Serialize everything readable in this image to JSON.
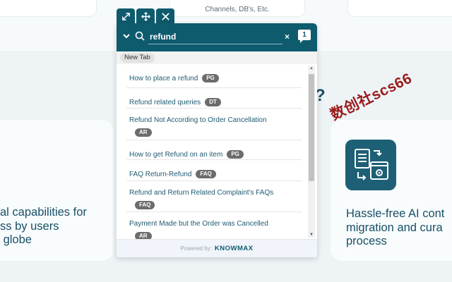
{
  "background": {
    "top_mid_card_text": "Channels, DB's, Etc.",
    "question_mark": "?",
    "left_text": "al capabilities for\nss by users\n globe",
    "right_text": "Hassle-free AI cont\nmigration and cura\nprocess",
    "watermark": "数创社scs66"
  },
  "widget": {
    "controls": [
      "expand-icon",
      "move-icon",
      "close-icon"
    ],
    "search": {
      "value": "refund",
      "placeholder": "Search",
      "clear_label": "×",
      "result_count": "1"
    },
    "tab_label": "New Tab",
    "results": [
      {
        "title": "How to place a refund",
        "tag": "PG"
      },
      {
        "title": "Refund related queries",
        "tag": "DT"
      },
      {
        "title": "Refund Not According to Order Cancellation",
        "tag": "AR"
      },
      {
        "title": "How to get Refund on an item",
        "tag": "PG"
      },
      {
        "title": "FAQ Return-Refund",
        "tag": "FAQ"
      },
      {
        "title": "Refund and Return Related Complaint's FAQs",
        "tag": "FAQ"
      },
      {
        "title": "Payment Made but the Order was Cancelled",
        "tag": "AR"
      }
    ],
    "footer": {
      "powered_by": "Powered by:",
      "brand": "KNOWMAX"
    }
  },
  "colors": {
    "header": "#0e5b6e",
    "tag": "#6c6c6c",
    "link": "#1d5a72",
    "background": "#eef4f6"
  }
}
